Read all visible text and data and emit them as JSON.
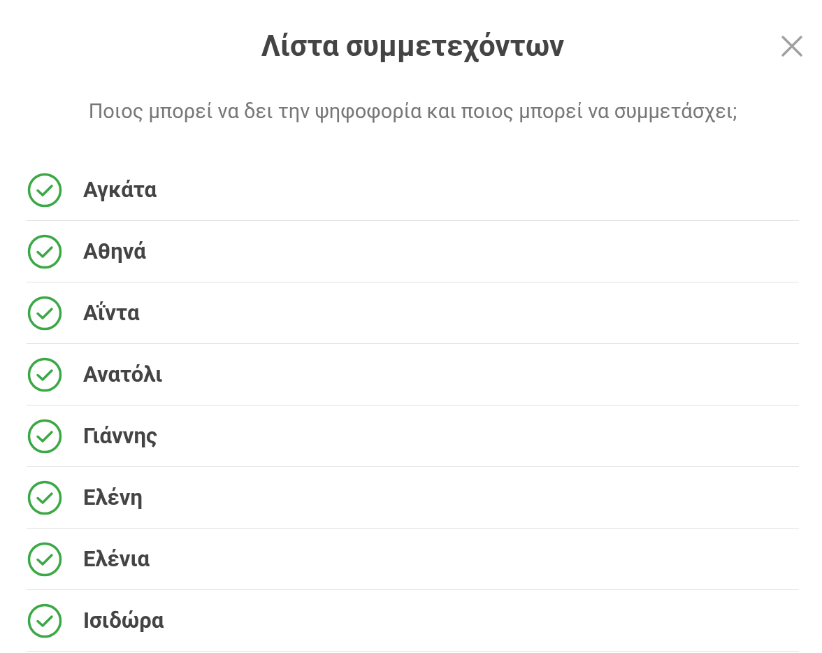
{
  "dialog": {
    "title": "Λίστα συμμετεχόντων",
    "subtitle": "Ποιος μπορεί να δει την ψηφοφορία και ποιος μπορεί να συμμετάσχει;"
  },
  "participants": [
    {
      "name": "Αγκάτα",
      "checked": true
    },
    {
      "name": "Αθηνά",
      "checked": true
    },
    {
      "name": "Αΐντα",
      "checked": true
    },
    {
      "name": "Ανατόλι",
      "checked": true
    },
    {
      "name": "Γιάννης",
      "checked": true
    },
    {
      "name": "Ελένη",
      "checked": true
    },
    {
      "name": "Ελένια",
      "checked": true
    },
    {
      "name": "Ισιδώρα",
      "checked": true
    }
  ]
}
